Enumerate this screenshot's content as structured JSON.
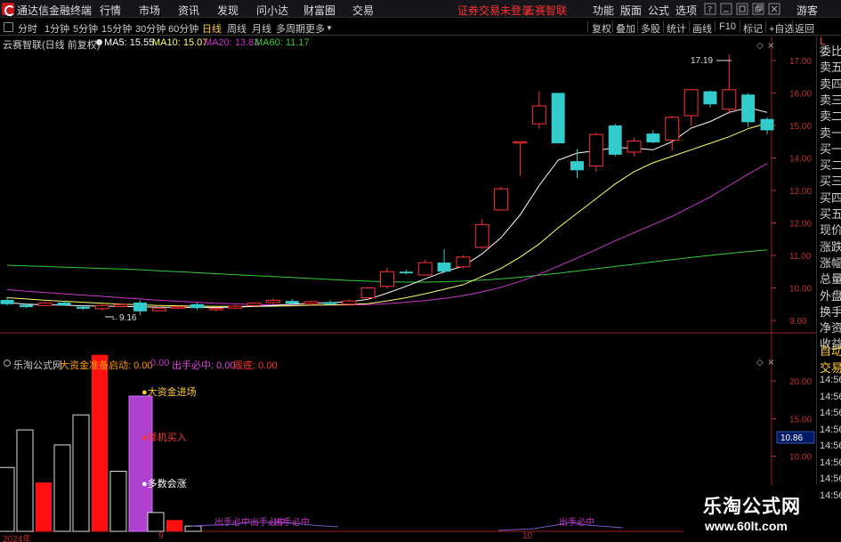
{
  "menubar": {
    "app_title": "通达信金融终端",
    "menus": [
      "行情",
      "市场",
      "资讯",
      "发现",
      "问小达",
      "财富圈",
      "交易"
    ],
    "notice": "证券交易未登录",
    "notice2": "云赛智联",
    "right_menus": [
      "功能",
      "版面",
      "公式",
      "选项"
    ],
    "guest": "游客"
  },
  "periodbar": {
    "periods": [
      "分时",
      "1分钟",
      "5分钟",
      "15分钟",
      "30分钟",
      "60分钟",
      "日线",
      "周线",
      "月线",
      "多周期",
      "更多"
    ],
    "active_period": "日线",
    "tools": [
      "复权",
      "叠加",
      "多股",
      "统计",
      "画线",
      "F10",
      "标记",
      "+自选",
      "返回"
    ]
  },
  "main_header": {
    "stock": "云赛智联(日线 前复权)",
    "ma5": "MA5: 15.55",
    "ma10": "MA10: 15.07",
    "ma20": "MA20: 13.83",
    "ma60": "MA60: 11.17"
  },
  "colors": {
    "ma5": "#ffffff",
    "ma10": "#ffff66",
    "ma20": "#cc33cc",
    "ma60": "#33cc33",
    "up": "#ff3333",
    "down": "#33cccc",
    "axis": "#c03030"
  },
  "price_axis": [
    "17.00",
    "16.00",
    "15.00",
    "14.00",
    "13.00",
    "12.00",
    "11.00",
    "10.00",
    "9.00"
  ],
  "annotations": {
    "high": "17.19",
    "low": "9.16"
  },
  "sub_header": {
    "indicator": "乐淘公式网",
    "f1": "大资金准备启动: 0.00",
    "f2": "0.00",
    "f3": "出手必中: 0.00",
    "f4": "毁底: 0.00"
  },
  "sub_axis": [
    "20.00",
    "15.00",
    "10.00"
  ],
  "sub_labels": {
    "l1": "大资金进场",
    "l2": "择机买入",
    "l3": "多数会涨",
    "l4": "出手必中出手必中",
    "l5": "出手必中",
    "l6": "出手必中"
  },
  "price_tag": "10.86",
  "date_labels": {
    "d1": "2024年",
    "d2": "9",
    "d3": "10"
  },
  "right_column": {
    "top": "L",
    "items": [
      "委比",
      "卖五",
      "卖四",
      "卖三",
      "卖二",
      "卖一",
      "买一",
      "买二",
      "买三",
      "买四",
      "买五",
      "现价",
      "涨跌",
      "涨幅",
      "总量",
      "外盘",
      "换手",
      "净资",
      "收益"
    ],
    "sub_items": [
      "自动",
      "交易",
      "14:56",
      "14:56",
      "14:56",
      "14:56",
      "14:56",
      "14:56",
      "14:56",
      "14:56"
    ]
  },
  "watermark": {
    "title": "乐淘公式网",
    "url": "www.60lt.com"
  },
  "chart_data": {
    "type": "candlestick",
    "candles": [
      {
        "o": 9.63,
        "c": 9.5,
        "h": 9.72,
        "l": 9.46
      },
      {
        "o": 9.48,
        "c": 9.41,
        "h": 9.52,
        "l": 9.38
      },
      {
        "o": 9.46,
        "c": 9.54,
        "h": 9.58,
        "l": 9.43
      },
      {
        "o": 9.55,
        "c": 9.47,
        "h": 9.6,
        "l": 9.45
      },
      {
        "o": 9.42,
        "c": 9.36,
        "h": 9.45,
        "l": 9.32
      },
      {
        "o": 9.36,
        "c": 9.46,
        "h": 9.5,
        "l": 9.3
      },
      {
        "o": 9.43,
        "c": 9.49,
        "h": 9.52,
        "l": 9.4
      },
      {
        "o": 9.55,
        "c": 9.28,
        "h": 9.62,
        "l": 9.16
      },
      {
        "o": 9.3,
        "c": 9.38,
        "h": 9.42,
        "l": 9.28
      },
      {
        "o": 9.38,
        "c": 9.42,
        "h": 9.45,
        "l": 9.34
      },
      {
        "o": 9.5,
        "c": 9.38,
        "h": 9.55,
        "l": 9.33
      },
      {
        "o": 9.35,
        "c": 9.37,
        "h": 9.4,
        "l": 9.28
      },
      {
        "o": 9.38,
        "c": 9.44,
        "h": 9.48,
        "l": 9.35
      },
      {
        "o": 9.46,
        "c": 9.53,
        "h": 9.56,
        "l": 9.42
      },
      {
        "o": 9.55,
        "c": 9.62,
        "h": 9.68,
        "l": 9.5
      },
      {
        "o": 9.6,
        "c": 9.52,
        "h": 9.66,
        "l": 9.47
      },
      {
        "o": 9.52,
        "c": 9.58,
        "h": 9.6,
        "l": 9.45
      },
      {
        "o": 9.56,
        "c": 9.5,
        "h": 9.62,
        "l": 9.46
      },
      {
        "o": 9.5,
        "c": 9.6,
        "h": 9.65,
        "l": 9.45
      },
      {
        "o": 9.7,
        "c": 10.0,
        "h": 10.03,
        "l": 9.62
      },
      {
        "o": 10.05,
        "c": 10.5,
        "h": 10.62,
        "l": 9.98
      },
      {
        "o": 10.5,
        "c": 10.45,
        "h": 10.56,
        "l": 10.42
      },
      {
        "o": 10.4,
        "c": 10.78,
        "h": 10.86,
        "l": 10.38
      },
      {
        "o": 10.78,
        "c": 10.5,
        "h": 11.2,
        "l": 10.45
      },
      {
        "o": 10.65,
        "c": 10.95,
        "h": 11.0,
        "l": 10.6
      },
      {
        "o": 11.25,
        "c": 11.95,
        "h": 12.12,
        "l": 11.2
      },
      {
        "o": 12.4,
        "c": 13.05,
        "h": 13.12,
        "l": 12.38
      },
      {
        "o": 14.5,
        "c": 14.5,
        "h": 14.5,
        "l": 13.45
      },
      {
        "o": 15.05,
        "c": 15.6,
        "h": 16.05,
        "l": 14.9
      },
      {
        "o": 16.0,
        "c": 14.45,
        "h": 16.0,
        "l": 14.45
      },
      {
        "o": 13.9,
        "c": 13.62,
        "h": 14.28,
        "l": 13.38
      },
      {
        "o": 13.75,
        "c": 14.72,
        "h": 14.78,
        "l": 13.58
      },
      {
        "o": 15.0,
        "c": 14.1,
        "h": 15.05,
        "l": 14.05
      },
      {
        "o": 14.18,
        "c": 14.52,
        "h": 14.62,
        "l": 14.05
      },
      {
        "o": 14.75,
        "c": 14.48,
        "h": 14.85,
        "l": 14.45
      },
      {
        "o": 14.55,
        "c": 15.25,
        "h": 15.3,
        "l": 14.22
      },
      {
        "o": 15.3,
        "c": 16.1,
        "h": 16.12,
        "l": 14.98
      },
      {
        "o": 16.05,
        "c": 15.65,
        "h": 16.08,
        "l": 15.55
      },
      {
        "o": 15.5,
        "c": 16.1,
        "h": 17.19,
        "l": 15.35
      },
      {
        "o": 15.95,
        "c": 15.1,
        "h": 16.0,
        "l": 14.95
      },
      {
        "o": 15.2,
        "c": 14.85,
        "h": 15.25,
        "l": 14.72
      }
    ],
    "ma5": [
      9.55,
      9.5,
      9.48,
      9.47,
      9.45,
      9.44,
      9.43,
      9.42,
      9.41,
      9.4,
      9.4,
      9.4,
      9.41,
      9.43,
      9.46,
      9.5,
      9.53,
      9.55,
      9.57,
      9.65,
      9.84,
      10.05,
      10.28,
      10.5,
      10.67,
      11.05,
      11.55,
      12.25,
      13.15,
      13.93,
      14.15,
      14.22,
      14.32,
      14.3,
      14.25,
      14.5,
      14.92,
      15.12,
      15.4,
      15.55,
      15.4
    ],
    "ma10": [
      9.7,
      9.66,
      9.62,
      9.59,
      9.56,
      9.53,
      9.5,
      9.48,
      9.46,
      9.45,
      9.44,
      9.43,
      9.43,
      9.43,
      9.44,
      9.45,
      9.47,
      9.48,
      9.49,
      9.52,
      9.6,
      9.7,
      9.82,
      9.96,
      10.1,
      10.35,
      10.6,
      10.95,
      11.35,
      11.85,
      12.3,
      12.75,
      13.2,
      13.58,
      13.85,
      14.05,
      14.25,
      14.45,
      14.65,
      14.9,
      15.07
    ],
    "ma20": [
      9.95,
      9.9,
      9.86,
      9.82,
      9.78,
      9.74,
      9.7,
      9.66,
      9.62,
      9.59,
      9.56,
      9.53,
      9.51,
      9.49,
      9.48,
      9.47,
      9.47,
      9.47,
      9.48,
      9.49,
      9.52,
      9.56,
      9.61,
      9.68,
      9.76,
      9.88,
      10.02,
      10.2,
      10.42,
      10.67,
      10.92,
      11.18,
      11.45,
      11.7,
      11.95,
      12.2,
      12.5,
      12.8,
      13.15,
      13.5,
      13.83
    ],
    "ma60": [
      10.7,
      10.68,
      10.66,
      10.64,
      10.62,
      10.6,
      10.58,
      10.56,
      10.53,
      10.5,
      10.47,
      10.44,
      10.41,
      10.38,
      10.35,
      10.32,
      10.29,
      10.26,
      10.23,
      10.21,
      10.19,
      10.18,
      10.18,
      10.19,
      10.21,
      10.24,
      10.28,
      10.33,
      10.39,
      10.45,
      10.52,
      10.59,
      10.66,
      10.73,
      10.8,
      10.87,
      10.94,
      11.0,
      11.06,
      11.12,
      11.17
    ],
    "volume_bars": [
      {
        "v": 8.5,
        "filled": false
      },
      {
        "v": 13.5,
        "filled": false
      },
      {
        "v": 6.5,
        "filled": true
      },
      {
        "v": 11.5,
        "filled": false
      },
      {
        "v": 15.5,
        "filled": false
      },
      {
        "v": 23.5,
        "filled": true
      },
      {
        "v": 8.0,
        "filled": false
      },
      {
        "v": 18.0,
        "filled": "purple"
      },
      {
        "v": 2.5,
        "filled": false
      },
      {
        "v": 1.5,
        "filled": true
      },
      {
        "v": 0.7,
        "filled": false
      }
    ],
    "y_range": [
      8.7,
      17.6
    ],
    "sub_y_range": [
      0,
      25
    ]
  }
}
